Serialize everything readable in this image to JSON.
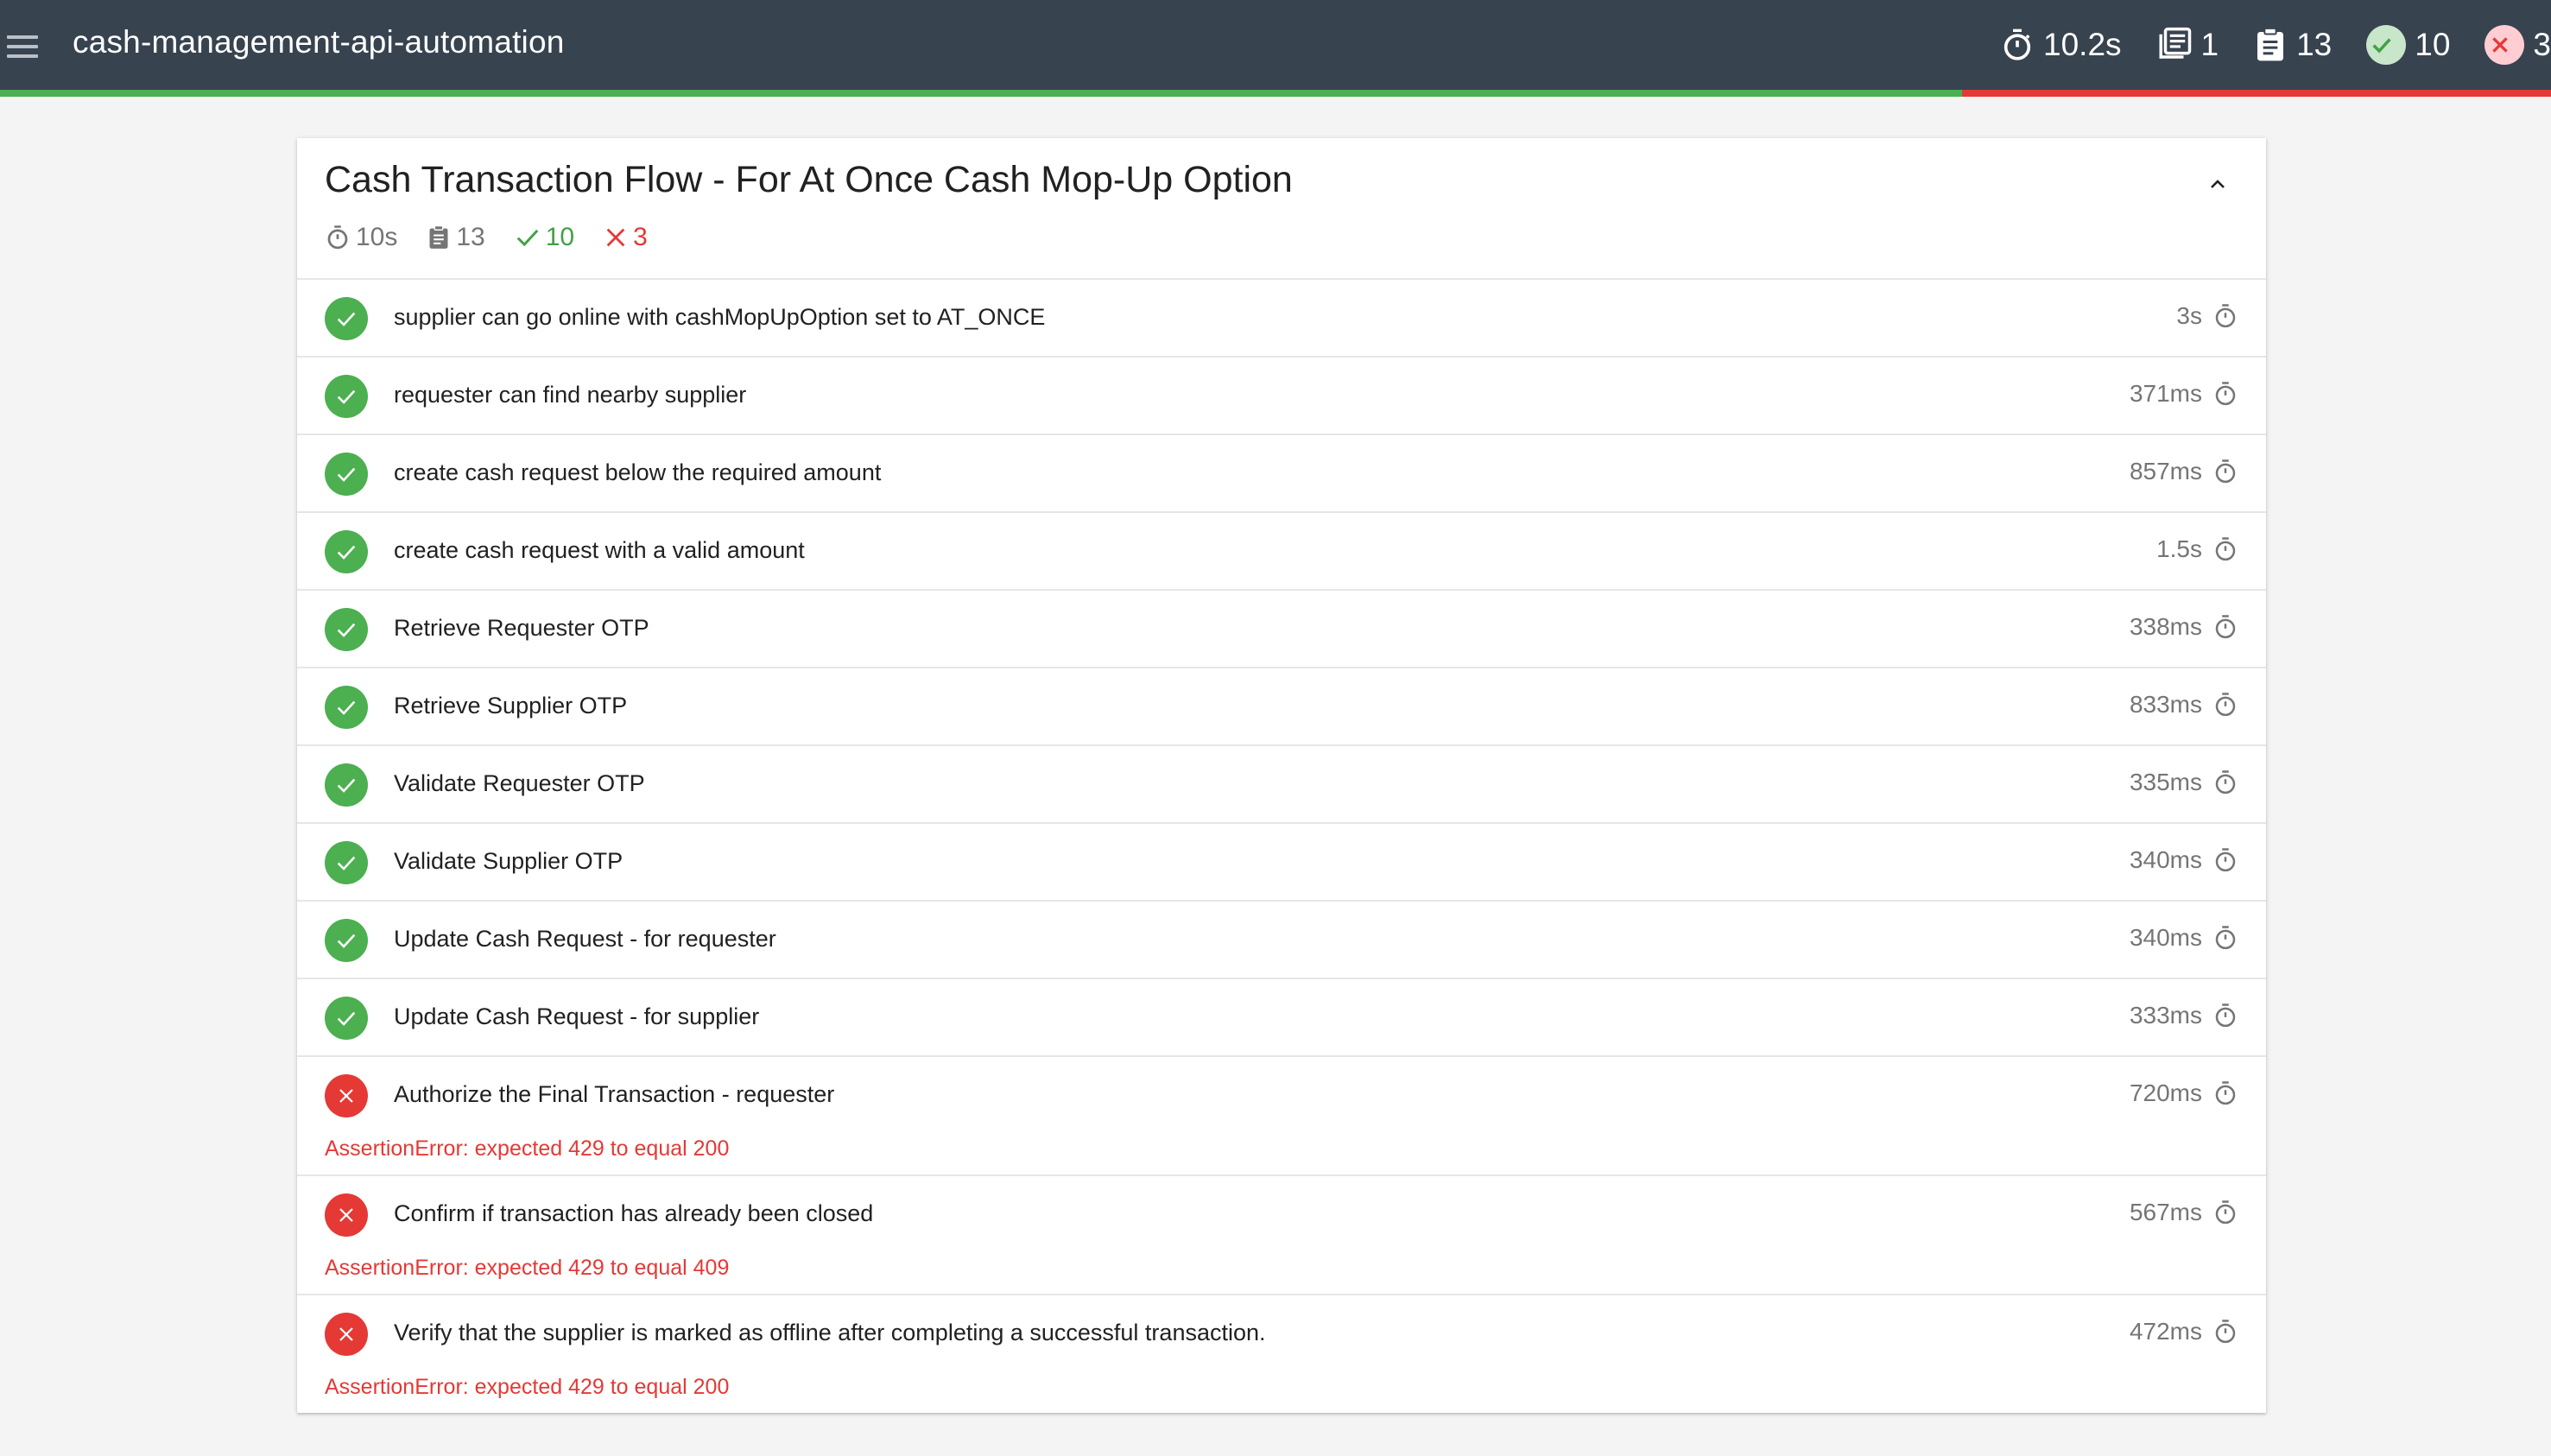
{
  "app": {
    "title": "cash-management-api-automation"
  },
  "stats": {
    "duration": "10.2s",
    "suites": "1",
    "tests": "13",
    "passes": "10",
    "failures": "3"
  },
  "progress": {
    "passes": 10,
    "failures": 3
  },
  "icons": {
    "menu": "hamburger-menu-icon",
    "timer": "stopwatch-icon",
    "suites": "library-books-icon",
    "tests": "clipboard-icon",
    "passes": "check-circle-icon",
    "failures": "x-circle-icon",
    "collapse": "chevron-up-icon"
  },
  "colors": {
    "topbar": "#37434f",
    "pass": "#4caf50",
    "fail": "#e53935",
    "muted": "#757575"
  },
  "suite": {
    "title": "Cash Transaction Flow - For At Once Cash Mop-Up Option",
    "duration": "10s",
    "tests": "13",
    "passes": "10",
    "failures": "3",
    "tests_list": [
      {
        "title": "supplier can go online with cashMopUpOption set to AT_ONCE",
        "duration": "3s",
        "state": "passed",
        "error": ""
      },
      {
        "title": "requester can find nearby supplier",
        "duration": "371ms",
        "state": "passed",
        "error": ""
      },
      {
        "title": "create cash request below the required amount",
        "duration": "857ms",
        "state": "passed",
        "error": ""
      },
      {
        "title": "create cash request with a valid amount",
        "duration": "1.5s",
        "state": "passed",
        "error": ""
      },
      {
        "title": "Retrieve Requester OTP",
        "duration": "338ms",
        "state": "passed",
        "error": ""
      },
      {
        "title": "Retrieve Supplier OTP",
        "duration": "833ms",
        "state": "passed",
        "error": ""
      },
      {
        "title": "Validate Requester OTP",
        "duration": "335ms",
        "state": "passed",
        "error": ""
      },
      {
        "title": "Validate Supplier OTP",
        "duration": "340ms",
        "state": "passed",
        "error": ""
      },
      {
        "title": "Update Cash Request - for requester",
        "duration": "340ms",
        "state": "passed",
        "error": ""
      },
      {
        "title": "Update Cash Request - for supplier",
        "duration": "333ms",
        "state": "passed",
        "error": ""
      },
      {
        "title": "Authorize the Final Transaction - requester",
        "duration": "720ms",
        "state": "failed",
        "error": "AssertionError: expected 429 to equal 200"
      },
      {
        "title": "Confirm if transaction has already been closed",
        "duration": "567ms",
        "state": "failed",
        "error": "AssertionError: expected 429 to equal 409"
      },
      {
        "title": "Verify that the supplier is marked as offline after completing a successful transaction.",
        "duration": "472ms",
        "state": "failed",
        "error": "AssertionError: expected 429 to equal 200"
      }
    ]
  }
}
